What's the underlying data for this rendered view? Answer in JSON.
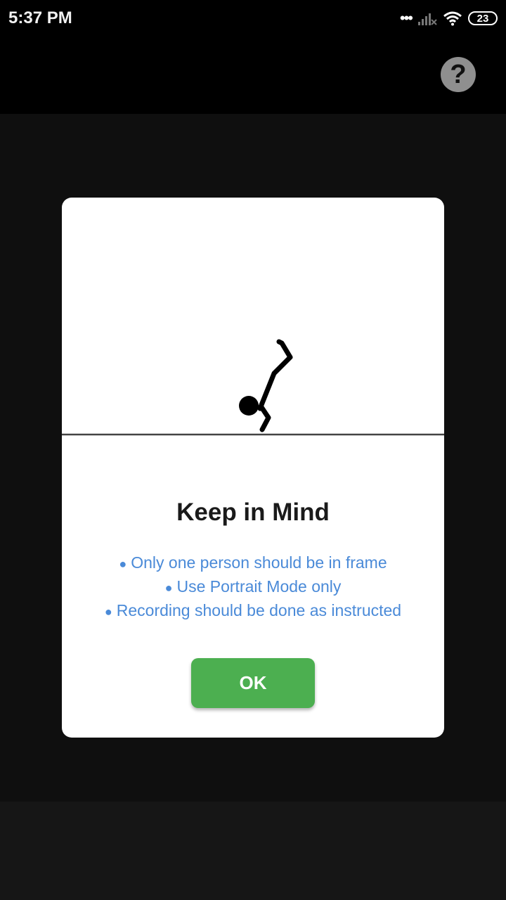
{
  "status_bar": {
    "time": "5:37 PM",
    "battery": "23",
    "icons": [
      "more-dots-icon",
      "signal-icon",
      "wifi-icon",
      "battery-icon"
    ]
  },
  "toolbar": {
    "help_label": "?"
  },
  "dialog": {
    "illustration": "handstand-stick-figure",
    "title": "Keep in Mind",
    "bullet": "●",
    "tips": [
      "Only one person should be in frame",
      "Use Portrait Mode only",
      "Recording should be done as instructed"
    ],
    "ok_label": "OK"
  },
  "colors": {
    "tip_text": "#4a8ad8",
    "ok_button": "#4caf50",
    "help_button": "#8f8f8f"
  }
}
